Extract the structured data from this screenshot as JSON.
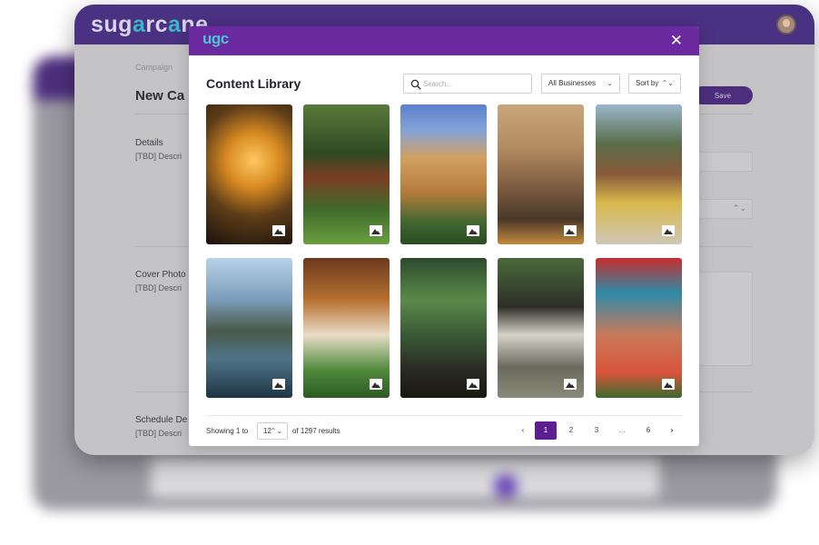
{
  "app": {
    "logo_text_start": "sug",
    "logo_text_accent": "a",
    "logo_text_mid": "rc",
    "logo_text_accent2": "a",
    "logo_text_end": "ne",
    "crumb": "Campaign",
    "page_title": "New Ca",
    "save_label": "Save",
    "sections": [
      {
        "label": "Details",
        "desc": "[TBD] Descri"
      },
      {
        "label": "Cover Photo",
        "desc": "[TBD] Descri"
      },
      {
        "label": "Schedule De",
        "desc": "[TBD] Descri"
      }
    ],
    "ghost_arrows": "⌃⌄"
  },
  "modal": {
    "logo": "ugc",
    "close_label": "✕",
    "title": "Content Library",
    "search": {
      "placeholder": "Search..."
    },
    "business_filter": {
      "selected": "All Businesses",
      "chevron": "⌄"
    },
    "sort": {
      "selected": "Sort by",
      "chevron": "⌃⌄"
    },
    "tiles": [
      {
        "name": "glass-building-night"
      },
      {
        "name": "tropical-courtyard"
      },
      {
        "name": "historic-apartment-building"
      },
      {
        "name": "rustic-dining-room"
      },
      {
        "name": "cliffside-stairs"
      },
      {
        "name": "riverside-terrace"
      },
      {
        "name": "wooden-porch-garden"
      },
      {
        "name": "garden-dining-room"
      },
      {
        "name": "tudor-house-path"
      },
      {
        "name": "colorful-townhouse"
      }
    ],
    "footer": {
      "showing_prefix": "Showing 1 to",
      "per_page": "12",
      "per_page_chevron": "⌃⌄",
      "results_text": "of 1297 results",
      "pages": {
        "prev": "‹",
        "p1": "1",
        "p2": "2",
        "p3": "3",
        "ellipsis": "...",
        "p6": "6",
        "next": "›"
      }
    }
  },
  "colors": {
    "modal_header": "#6b2aa0",
    "app_header": "#4a3182",
    "active_page": "#5d1f8f",
    "logo_accent": "#4fc4d4"
  }
}
